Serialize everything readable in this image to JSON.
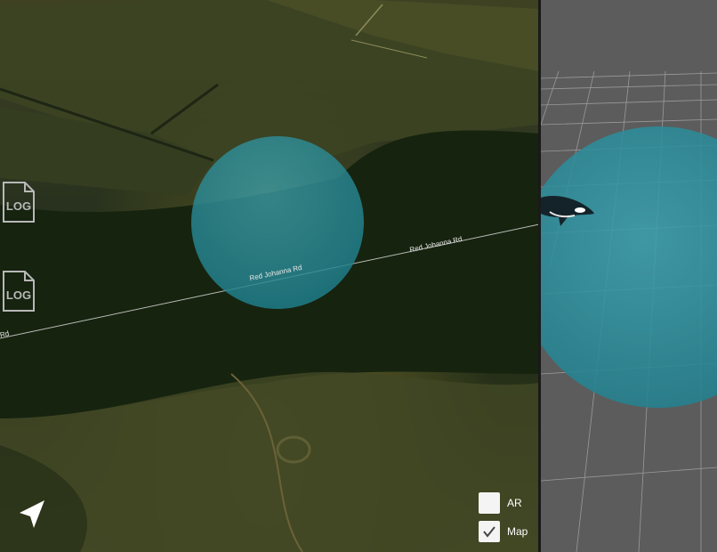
{
  "map": {
    "road_labels": [
      "Red Johanna Rd",
      "Red Johanna Rd",
      "Rd"
    ],
    "log_icon_text": "LOG"
  },
  "toggles": [
    {
      "label": "AR",
      "checked": false
    },
    {
      "label": "Map",
      "checked": true
    }
  ],
  "icons": {
    "locate": "navigation-arrow-icon",
    "log": "log-file-icon",
    "whale": "orca-model"
  },
  "colors": {
    "sphere": "#2a8c9a",
    "scene_background": "#5c5c5c",
    "grid": "#bdbdbd"
  }
}
